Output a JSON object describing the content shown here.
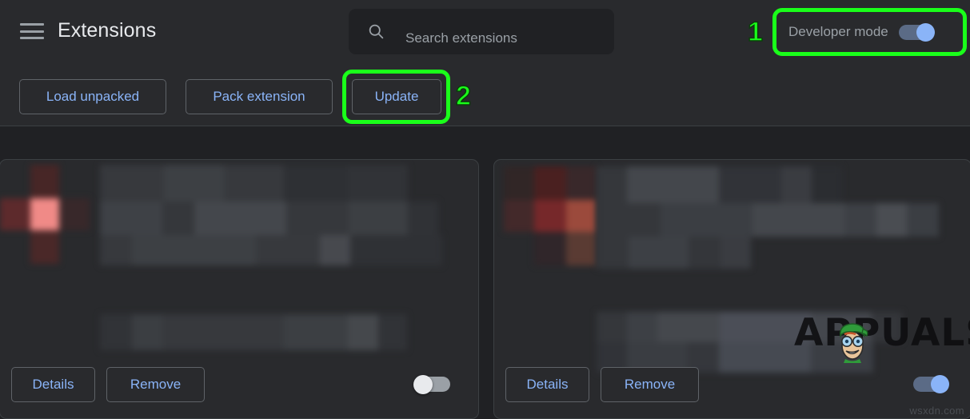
{
  "header": {
    "menu_icon": "hamburger-menu-icon",
    "title": "Extensions",
    "search": {
      "icon": "search-icon",
      "placeholder": "Search extensions",
      "value": ""
    },
    "developer_mode": {
      "label": "Developer mode",
      "state": "on",
      "toggle_icon": "toggle-switch-on"
    }
  },
  "toolbar": {
    "load_unpacked_label": "Load unpacked",
    "pack_extension_label": "Pack extension",
    "update_label": "Update"
  },
  "cards": [
    {
      "details_label": "Details",
      "remove_label": "Remove",
      "enabled_state": "off",
      "toggle_icon": "toggle-switch-off",
      "name_redacted": true,
      "description_redacted": true
    },
    {
      "details_label": "Details",
      "remove_label": "Remove",
      "enabled_state": "on",
      "toggle_icon": "toggle-switch-on",
      "name_redacted": true,
      "description_redacted": true
    }
  ],
  "annotations": [
    {
      "number": "1",
      "target": "developer-mode-toggle",
      "color": "#1aff1a"
    },
    {
      "number": "2",
      "target": "update-button",
      "color": "#1aff1a"
    }
  ],
  "watermarks": {
    "brand_text": "APPUALS",
    "mascot_icon": "appuals-mascot-icon",
    "site_credit": "wsxdn.com"
  },
  "colors": {
    "page_background": "#202124",
    "surface": "#292a2d",
    "accent_blue": "#8ab4f8",
    "text_primary": "#e8eaed",
    "text_secondary": "#9aa0a6",
    "border": "#5f6368",
    "annotation_green": "#1aff1a"
  }
}
